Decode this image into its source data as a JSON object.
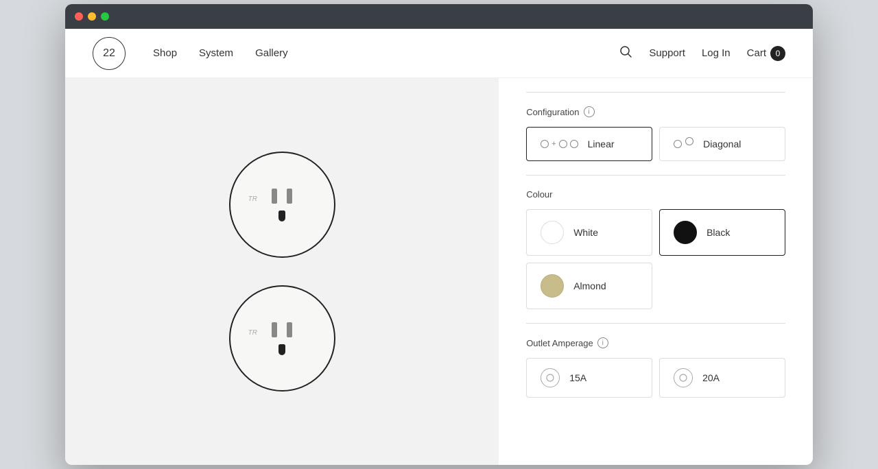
{
  "browser": {
    "dots": [
      "red",
      "yellow",
      "green"
    ]
  },
  "nav": {
    "logo_text": "22",
    "links": [
      {
        "label": "Shop",
        "href": "#"
      },
      {
        "label": "System",
        "href": "#"
      },
      {
        "label": "Gallery",
        "href": "#"
      }
    ],
    "right_links": [
      {
        "label": "Support",
        "href": "#"
      },
      {
        "label": "Log In",
        "href": "#"
      }
    ],
    "cart_label": "Cart",
    "cart_count": "0"
  },
  "product": {
    "configuration": {
      "label": "Configuration",
      "options": [
        {
          "id": "linear",
          "label": "Linear",
          "selected": true
        },
        {
          "id": "diagonal",
          "label": "Diagonal",
          "selected": false
        }
      ]
    },
    "colour": {
      "label": "Colour",
      "options": [
        {
          "id": "white",
          "label": "White",
          "swatch": "white",
          "selected": false
        },
        {
          "id": "black",
          "label": "Black",
          "swatch": "black",
          "selected": true
        },
        {
          "id": "almond",
          "label": "Almond",
          "swatch": "almond",
          "selected": false
        }
      ]
    },
    "amperage": {
      "label": "Outlet Amperage",
      "options": [
        {
          "id": "15a",
          "label": "15A",
          "selected": false
        },
        {
          "id": "20a",
          "label": "20A",
          "selected": false
        }
      ]
    }
  }
}
